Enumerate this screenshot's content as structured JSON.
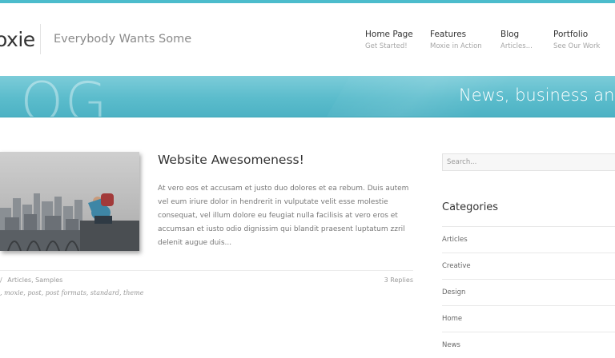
{
  "header": {
    "logo": "oxie",
    "tagline": "Everybody Wants Some",
    "nav": [
      {
        "title": "Home Page",
        "subtitle": "Get Started!"
      },
      {
        "title": "Features",
        "subtitle": "Moxie in Action"
      },
      {
        "title": "Blog",
        "subtitle": "Articles..."
      },
      {
        "title": "Portfolio",
        "subtitle": "See Our Work"
      }
    ]
  },
  "banner": {
    "title": "LOG",
    "slogan": "News, business and m"
  },
  "post": {
    "title": "Website Awesomeness!",
    "excerpt": "At vero eos et accusam et justo duo dolores et ea rebum. Duis autem vel eum iriure dolor in hendrerit in vulputate velit esse molestie consequat, vel illum dolore eu feugiat nulla facilisis at vero eros et accumsan et iusto odio dignissim qui blandit praesent luptatum zzril delenit augue duis...",
    "meta_separator": "/",
    "categories": "Articles, Samples",
    "tags": ", moxie, post, post formats, standard, theme",
    "replies": "3 Replies"
  },
  "sidebar": {
    "search_placeholder": "Search...",
    "categories_heading": "Categories",
    "categories": [
      "Articles",
      "Creative",
      "Design",
      "Home",
      "News"
    ]
  },
  "colors": {
    "accent": "#4cbccc",
    "banner": "#5bbccc"
  }
}
